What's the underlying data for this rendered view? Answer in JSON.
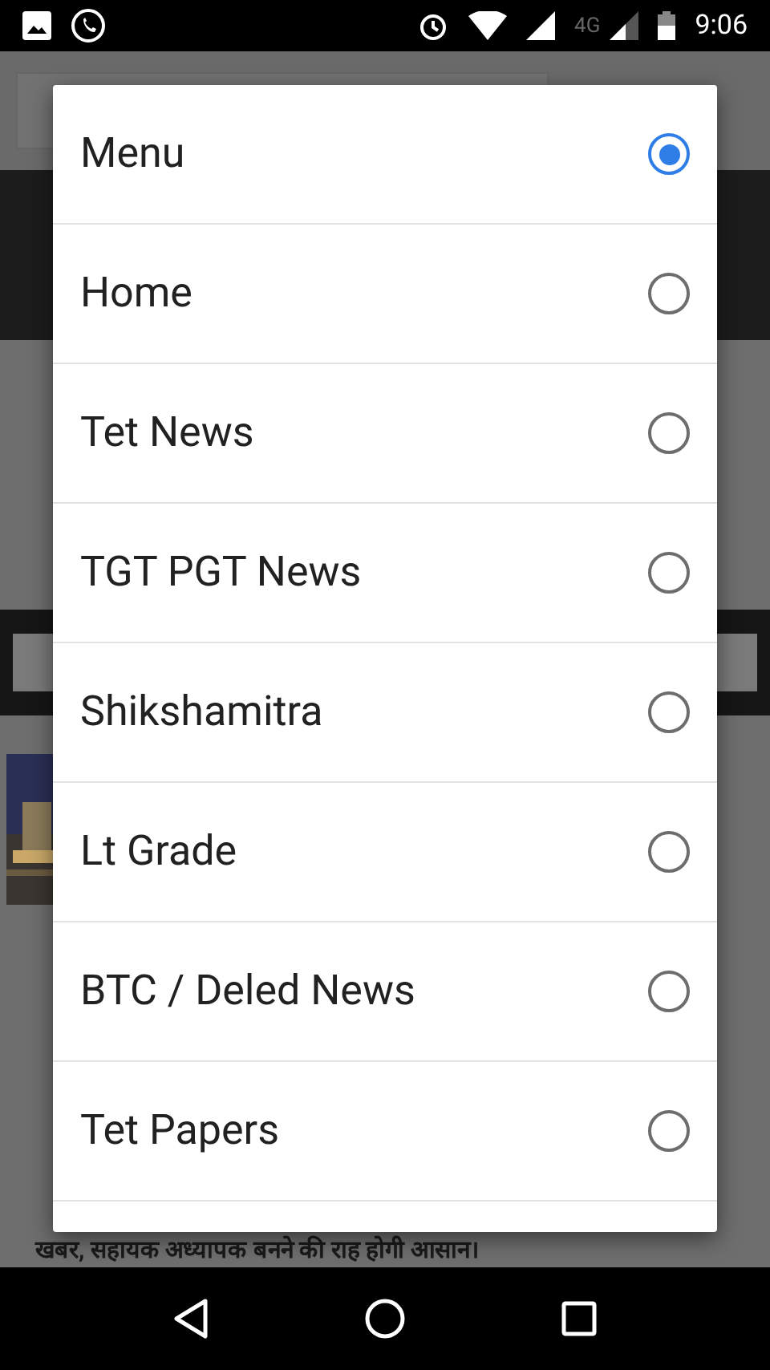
{
  "status_bar": {
    "network": "4G",
    "time": "9:06"
  },
  "background_page": {
    "headline": "खबर, सहायक अध्यापक बनने की राह होगी आसान।"
  },
  "dialog": {
    "options": [
      {
        "label": "Menu",
        "selected": true
      },
      {
        "label": "Home",
        "selected": false
      },
      {
        "label": "Tet News",
        "selected": false
      },
      {
        "label": "TGT PGT News",
        "selected": false
      },
      {
        "label": "Shikshamitra",
        "selected": false
      },
      {
        "label": "Lt Grade",
        "selected": false
      },
      {
        "label": "BTC / Deled News",
        "selected": false
      },
      {
        "label": "Tet Papers",
        "selected": false
      }
    ]
  }
}
